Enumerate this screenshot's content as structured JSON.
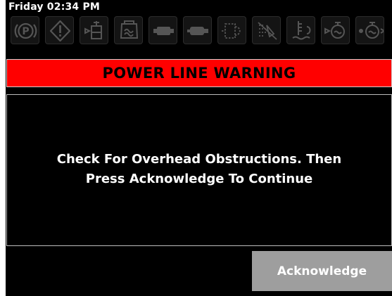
{
  "status_bar": {
    "time": "Friday 02:34 PM"
  },
  "indicators": [
    {
      "name": "parking-brake-icon"
    },
    {
      "name": "general-warning-icon"
    },
    {
      "name": "hydraulic-oil-icon"
    },
    {
      "name": "coolant-icon"
    },
    {
      "name": "battery-charge-icon"
    },
    {
      "name": "hydraulic-filter-icon"
    },
    {
      "name": "transmission-icon"
    },
    {
      "name": "fuel-filter-icon"
    },
    {
      "name": "hydraulic-oil-temperature-icon"
    },
    {
      "name": "engine-icon"
    },
    {
      "name": "engine-oil-icon"
    }
  ],
  "warning": {
    "title": "POWER LINE WARNING"
  },
  "message": {
    "line1": "Check For Overhead Obstructions. Then",
    "line2": "Press Acknowledge To Continue"
  },
  "actions": {
    "acknowledge_label": "Acknowledge"
  },
  "colors": {
    "banner": "#ff0000",
    "screen": "#000000",
    "button": "#9e9e9e",
    "icon": "#555555"
  }
}
